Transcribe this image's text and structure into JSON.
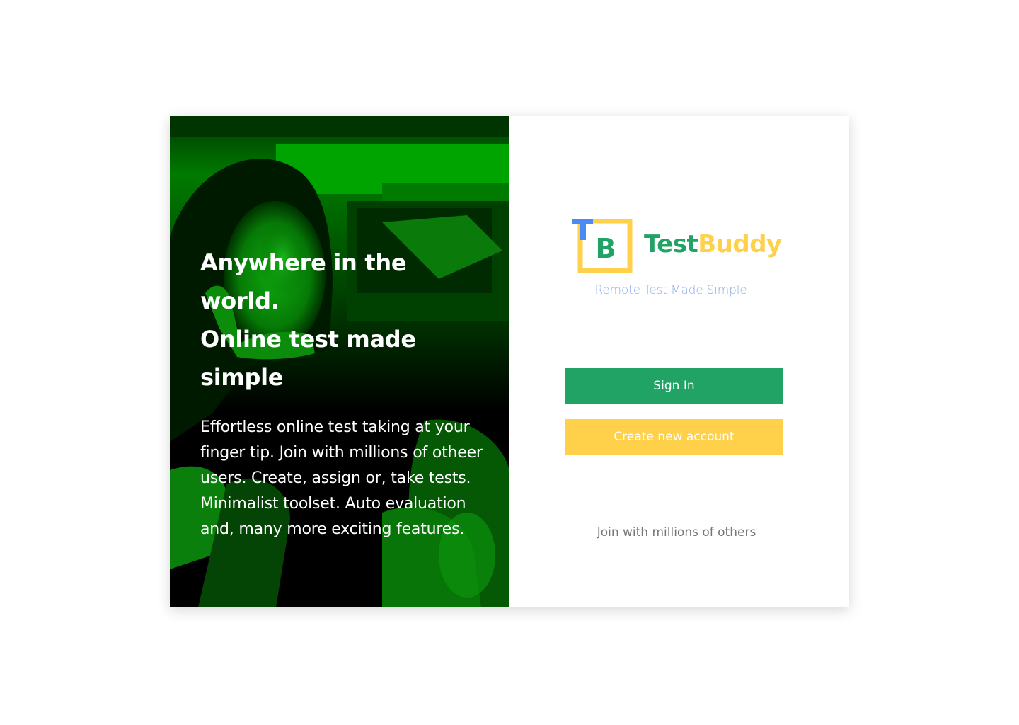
{
  "hero": {
    "headline_line1": "Anywhere in the world.",
    "headline_line2": "Online test made simple",
    "body": "Effortless online test taking at your finger tip. Join with millions of otheer users. Create, assign or, take tests. Minimalist toolset. Auto evaluation and, many more exciting features."
  },
  "brand": {
    "logo_letters": {
      "t": "T",
      "b": "B"
    },
    "name_part1": "Test",
    "name_part2": "Buddy",
    "tagline": "Remote Test Made Simple"
  },
  "actions": {
    "signin_label": "Sign In",
    "create_label": "Create new account"
  },
  "footer": {
    "join_text": "Join with millions of others"
  },
  "colors": {
    "primary_green": "#21a366",
    "accent_yellow": "#ffd04a",
    "logo_blue": "#4b8af0",
    "tagline_blue": "#8fb0e8",
    "hero_overlay_green": "#00a000"
  }
}
